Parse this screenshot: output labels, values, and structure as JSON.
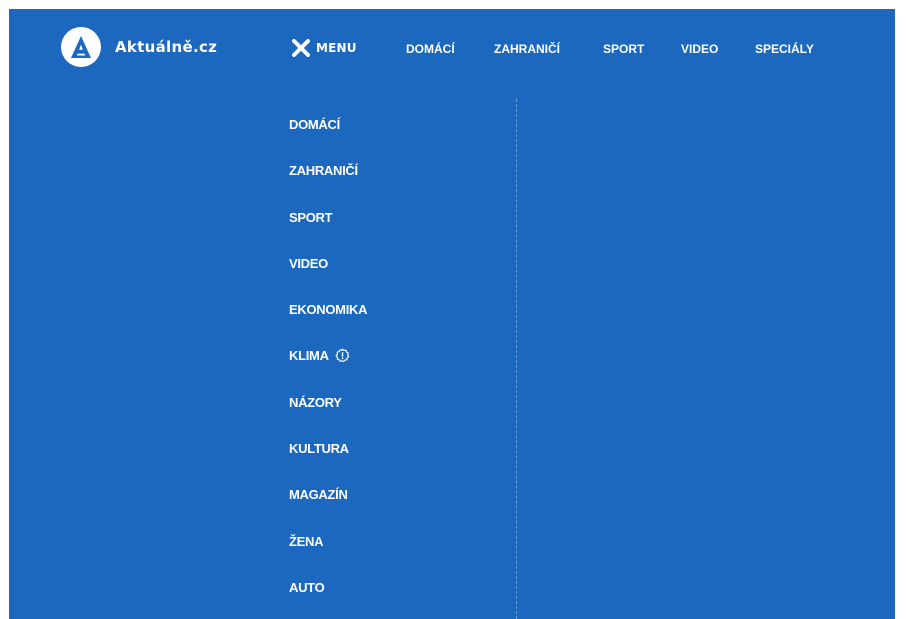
{
  "brand": {
    "logo_letter": "A",
    "name": "Aktuálně.cz"
  },
  "menu_toggle": {
    "label": "MENU",
    "icon": "close-icon"
  },
  "top_nav": [
    {
      "label": "DOMÁCÍ"
    },
    {
      "label": "ZAHRANIČÍ"
    },
    {
      "label": "SPORT"
    },
    {
      "label": "VIDEO"
    },
    {
      "label": "SPECIÁLY"
    }
  ],
  "side_menu": [
    {
      "label": "DOMÁCÍ"
    },
    {
      "label": "ZAHRANIČÍ"
    },
    {
      "label": "SPORT"
    },
    {
      "label": "VIDEO"
    },
    {
      "label": "EKONOMIKA"
    },
    {
      "label": "KLIMA",
      "icon": "alert-badge-icon"
    },
    {
      "label": "NÁZORY"
    },
    {
      "label": "KULTURA"
    },
    {
      "label": "MAGAZÍN"
    },
    {
      "label": "ŽENA"
    },
    {
      "label": "AUTO"
    }
  ],
  "colors": {
    "background": "#1b68be",
    "text": "#ffffff"
  }
}
